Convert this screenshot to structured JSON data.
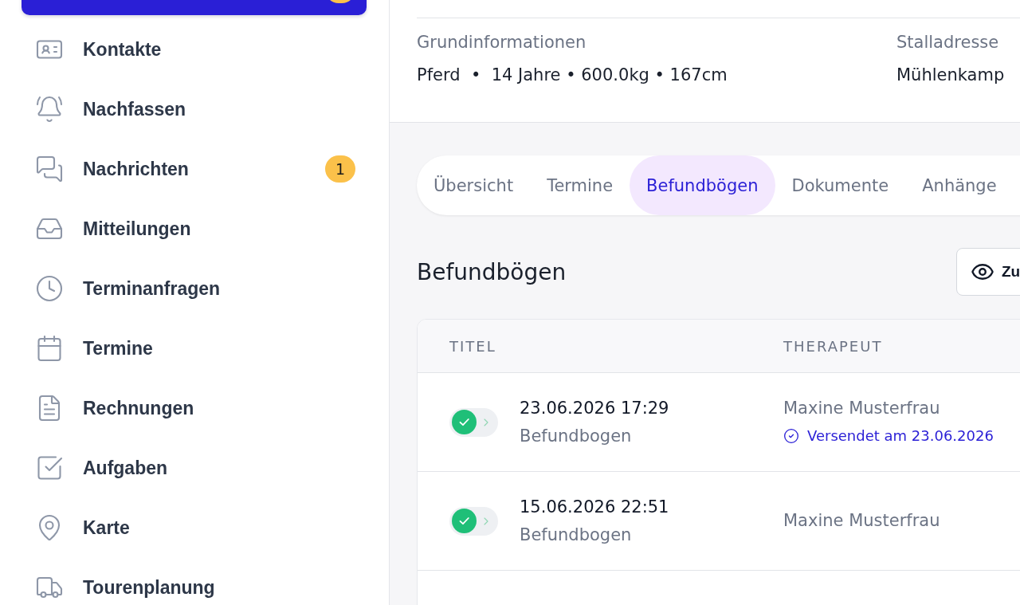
{
  "sidebar": {
    "items": [
      {
        "selected": true,
        "has_badge": true
      },
      {
        "label": "Kontakte",
        "selected": false
      },
      {
        "label": "Nachfassen",
        "selected": false
      },
      {
        "label": "Nachrichten",
        "selected": false,
        "badge": "1"
      },
      {
        "label": "Mitteilungen",
        "selected": false
      },
      {
        "label": "Terminanfragen",
        "selected": false
      },
      {
        "label": "Termine",
        "selected": false
      },
      {
        "label": "Rechnungen",
        "selected": false
      },
      {
        "label": "Aufgaben",
        "selected": false
      },
      {
        "label": "Karte",
        "selected": false
      },
      {
        "label": "Tourenplanung",
        "selected": false
      }
    ]
  },
  "header": {
    "fields": [
      {
        "label": "Grundinformationen",
        "value": "Pferd  •  14 Jahre • 600.0kg • 167cm"
      },
      {
        "label": "Stalladresse",
        "value": "Mühlenkamp"
      }
    ]
  },
  "tabs": [
    {
      "label": "Übersicht",
      "selected": false
    },
    {
      "label": "Termine",
      "selected": false
    },
    {
      "label": "Befundbögen",
      "selected": true
    },
    {
      "label": "Dokumente",
      "selected": false
    },
    {
      "label": "Anhänge",
      "selected": false
    }
  ],
  "section": {
    "title": "Befundbögen",
    "button": {
      "label": "Zu"
    }
  },
  "table": {
    "columns": [
      "TITEL",
      "THERAPEUT"
    ],
    "rows": [
      {
        "done": true,
        "date": "23.06.2026 17:29",
        "title": "Befundbogen",
        "therapist": "Maxine Musterfrau",
        "sent": "Versendet am 23.06.2026"
      },
      {
        "done": true,
        "date": "15.06.2026 22:51",
        "title": "Befundbogen",
        "therapist": "Maxine Musterfrau"
      }
    ]
  }
}
